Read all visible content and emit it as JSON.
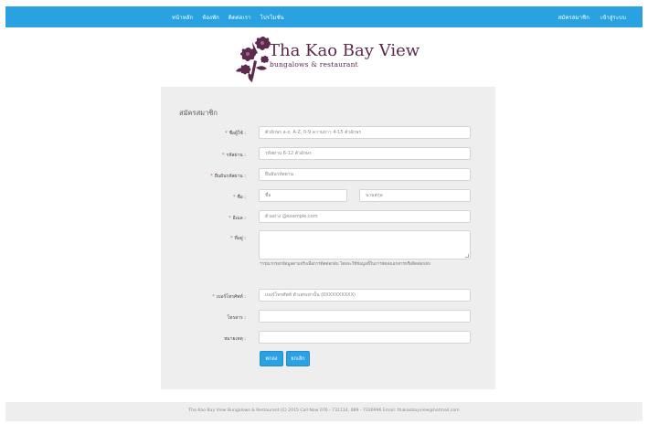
{
  "nav": {
    "left_items": [
      {
        "label": "หน้าหลัก"
      },
      {
        "label": "ห้องพัก"
      },
      {
        "label": "ติดต่อเรา"
      },
      {
        "label": "โปรโมชั่น"
      }
    ],
    "right_items": [
      {
        "label": "สมัครสมาชิก"
      },
      {
        "label": "เข้าสู่ระบบ"
      }
    ],
    "bar_color": "#2aa1e0"
  },
  "logo": {
    "title": "Tha Kao Bay View",
    "subtitle": "bungalows & restaurant",
    "color": "#5b2a4e",
    "icon": "flower-logo-icon"
  },
  "form": {
    "title": "สมัครสมาชิก",
    "required_mark": "*",
    "fields": {
      "username": {
        "label": "ชื่อผู้ใช้ :",
        "placeholder": "ตัวอักษร a-z, A-Z, 0-9 ความยาว 4-15 ตัวอักษร"
      },
      "password": {
        "label": "รหัสผ่าน :",
        "placeholder": "รหัสผ่าน 6-12 ตัวอักษร"
      },
      "confirm_password": {
        "label": "ยืนยันรหัสผ่าน :",
        "placeholder": "ยืนยันรหัสผ่าน"
      },
      "first_name": {
        "label": "ชื่อ :",
        "placeholder": "ชื่อ"
      },
      "last_name": {
        "placeholder": "นามสกุล"
      },
      "email": {
        "label": "อีเมล :",
        "placeholder": "ตัวอย่าง @example.com"
      },
      "address": {
        "label": "ที่อยู่ :",
        "hint": "*กรุณากรอกข้อมูลตามจริงเพื่อการติดต่อกลับ โดยจะใช้ข้อมูลนี้ในการจัดส่งเอกสารหรือติดต่อกลับ"
      },
      "phone": {
        "label": "เบอร์โทรศัพท์ :",
        "placeholder": "เบอร์โทรศัพท์ ตัวเลขเท่านั้น (0XXXXXXXXX)"
      },
      "fax": {
        "label": "โทรสาร :",
        "placeholder": ""
      },
      "note": {
        "label": "หมายเหตุ :",
        "placeholder": ""
      }
    },
    "buttons": {
      "submit": "ตกลง",
      "cancel": "ยกเลิก"
    }
  },
  "footer": {
    "text": "Tha Kao Bay View Bungalows & Restaurant (C) 2015 Call Now 076 - 731114, 089 - 7336996 Email: thakaobayview@hotmail.com"
  }
}
